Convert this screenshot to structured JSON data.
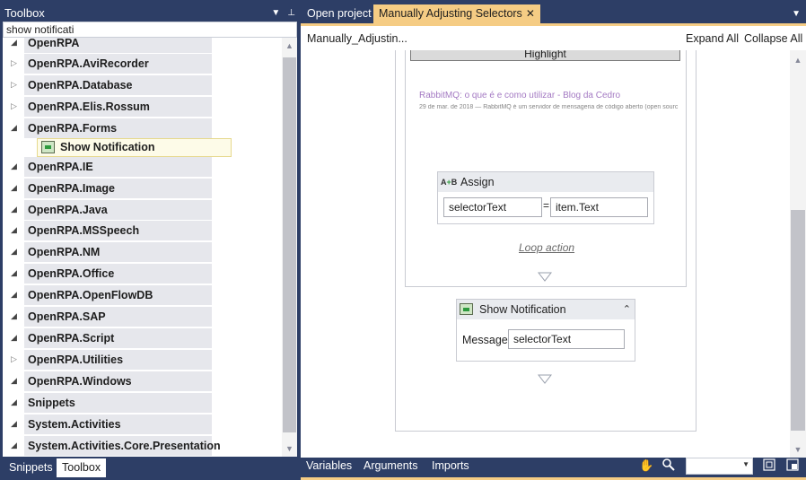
{
  "toolbox": {
    "title": "Toolbox",
    "search_value": "show notificati",
    "categories": [
      {
        "label": "OpenRPA",
        "expanded": true
      },
      {
        "label": "OpenRPA.AviRecorder",
        "expanded": false
      },
      {
        "label": "OpenRPA.Database",
        "expanded": false
      },
      {
        "label": "OpenRPA.Elis.Rossum",
        "expanded": false
      },
      {
        "label": "OpenRPA.Forms",
        "expanded": true
      },
      {
        "label": "OpenRPA.IE",
        "expanded": true
      },
      {
        "label": "OpenRPA.Image",
        "expanded": true
      },
      {
        "label": "OpenRPA.Java",
        "expanded": true
      },
      {
        "label": "OpenRPA.MSSpeech",
        "expanded": true
      },
      {
        "label": "OpenRPA.NM",
        "expanded": true
      },
      {
        "label": "OpenRPA.Office",
        "expanded": true
      },
      {
        "label": "OpenRPA.OpenFlowDB",
        "expanded": true
      },
      {
        "label": "OpenRPA.SAP",
        "expanded": true
      },
      {
        "label": "OpenRPA.Script",
        "expanded": true
      },
      {
        "label": "OpenRPA.Utilities",
        "expanded": false
      },
      {
        "label": "OpenRPA.Windows",
        "expanded": true
      },
      {
        "label": "Snippets",
        "expanded": true
      },
      {
        "label": "System.Activities",
        "expanded": true
      },
      {
        "label": "System.Activities.Core.Presentation",
        "expanded": true
      }
    ],
    "selected_item": "Show Notification",
    "bottom_tabs": [
      "Snippets",
      "Toolbox"
    ]
  },
  "doc_tabs": [
    {
      "label": "Open project",
      "active": false
    },
    {
      "label": "Manually Adjusting Selectors",
      "active": true,
      "close": "✕"
    }
  ],
  "designer": {
    "breadcrumb": "Manually_Adjustin...",
    "expand_all": "Expand All",
    "collapse_all": "Collapse All",
    "highlight_label": "Highlight",
    "preview_title": "RabbitMQ: o que é e como utilizar - Blog da Cedro",
    "preview_snippet": "29 de mar. de 2018 — RabbitMQ é um servidor de mensageria de código aberto (open sourc",
    "assign": {
      "title": "Assign",
      "to": "selectorText",
      "eq": "=",
      "value": "item.Text"
    },
    "loop_action": "Loop action",
    "notification": {
      "title": "Show Notification",
      "message_label": "Message",
      "message_value": "selectorText"
    }
  },
  "bottom_bar": {
    "variables": "Variables",
    "arguments": "Arguments",
    "imports": "Imports"
  },
  "colors": {
    "chrome": "#2d3e66",
    "accent_tab": "#f5cc84",
    "category_bg": "#e6e7ec"
  }
}
